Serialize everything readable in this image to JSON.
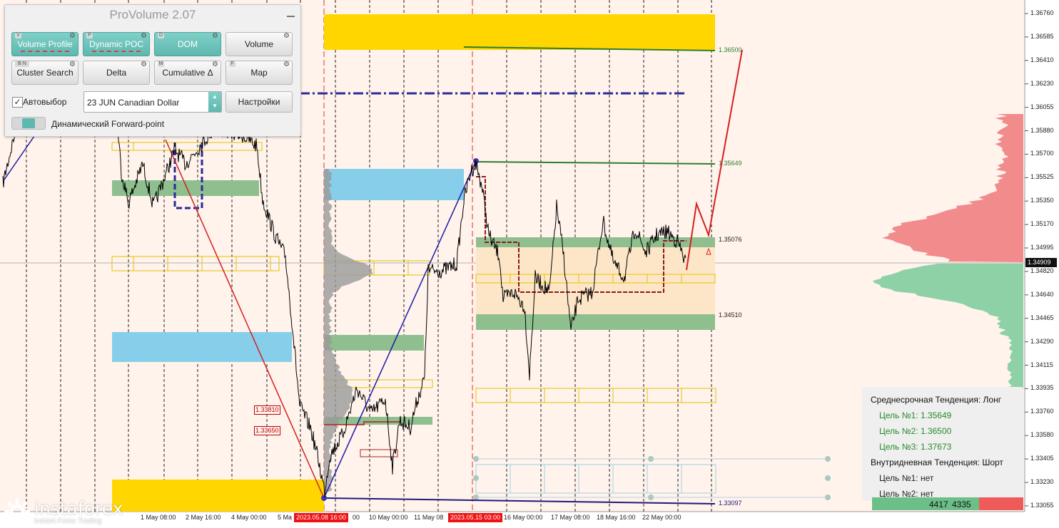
{
  "panel": {
    "title": "ProVolume 2.07",
    "buttons": [
      {
        "key": "V",
        "label": "Volume Profile",
        "active": true
      },
      {
        "key": "P",
        "label": "Dynamic POC",
        "active": true
      },
      {
        "key": "D",
        "label": "DOM",
        "active": true
      },
      {
        "key": "",
        "label": "Volume",
        "active": false
      },
      {
        "key": "B  N",
        "label": "Cluster Search",
        "active": false
      },
      {
        "key": "",
        "label": "Delta",
        "active": false
      },
      {
        "key": "M",
        "label": "Cumulative Δ",
        "active": false
      },
      {
        "key": "F",
        "label": "Map",
        "active": false
      }
    ],
    "autoselect_label": "Автовыбор",
    "autoselect_checked": true,
    "instrument_value": "23 JUN Canadian Dollar",
    "settings_label": "Настройки",
    "forward_point_label": "Динамический Forward-point"
  },
  "price_axis": {
    "labels": [
      "1.36760",
      "1.36585",
      "1.36410",
      "1.36230",
      "1.36055",
      "1.35880",
      "1.35700",
      "1.35525",
      "1.35350",
      "1.35170",
      "1.34995",
      "1.34820",
      "1.34640",
      "1.34465",
      "1.34290",
      "1.34115",
      "1.33935",
      "1.33760",
      "1.33580",
      "1.33405",
      "1.33230",
      "1.33055"
    ],
    "current_price": "1.34909"
  },
  "time_axis": {
    "labels": [
      "1 May 08:00",
      "2 May 16:00",
      "4 May 00:00",
      "5 Ma",
      "10 May 00:00",
      "11 May 08",
      "16 May 00:00",
      "17 May 08:00",
      "18 May 16:00",
      "22 May 00:00"
    ],
    "highlighted": [
      "2023.05.08 16:00",
      "2023.05.15 03:00"
    ],
    "partial": [
      "00"
    ]
  },
  "levels": {
    "target3": "1.36500",
    "target1": "1.35649",
    "upper_range": "1.35076",
    "lower_range": "1.34510",
    "bottom": "1.33097",
    "box1": "1.33810",
    "box2": "1.33650"
  },
  "info_panel": {
    "medium_trend": "Среднесрочная Тенденция: Лонг",
    "medium_targets": [
      "Цель №1: 1.35649",
      "Цель №2: 1.36500",
      "Цель №3: 1.37673"
    ],
    "intraday_trend": "Внутридневная Тенденция: Шорт",
    "intraday_targets": [
      "Цель №1: нет",
      "Цель №2: нет"
    ]
  },
  "volume_bar": {
    "buy": "4417",
    "sell": "4335"
  },
  "logo": {
    "wordmark": "instaforex",
    "slogan": "Instant Forex Trading"
  },
  "colors": {
    "background": "#fff3ec",
    "yellow_zone": "#ffd600",
    "blue_zone": "#87ceeb",
    "green_zone": "#8fbf8f",
    "range_fill": "#fde6c8",
    "active_button": "#5fb8af",
    "buy_volume": "#6bbf87",
    "sell_volume": "#ef5b5b"
  }
}
